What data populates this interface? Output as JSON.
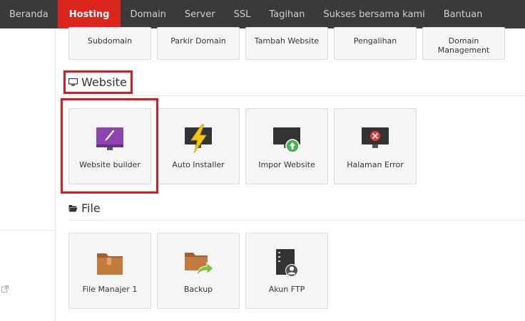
{
  "nav": {
    "items": [
      {
        "label": "Beranda",
        "active": false
      },
      {
        "label": "Hosting",
        "active": true
      },
      {
        "label": "Domain",
        "active": false
      },
      {
        "label": "Server",
        "active": false
      },
      {
        "label": "SSL",
        "active": false
      },
      {
        "label": "Tagihan",
        "active": false
      },
      {
        "label": "Sukses bersama kami",
        "active": false
      },
      {
        "label": "Bantuan",
        "active": false
      }
    ]
  },
  "domain_tiles": [
    {
      "label": "Subdomain"
    },
    {
      "label": "Parkir Domain"
    },
    {
      "label": "Tambah Website"
    },
    {
      "label": "Pengalihan"
    },
    {
      "label": "Domain Management"
    }
  ],
  "website_section": {
    "title": "Website",
    "icon": "monitor-icon",
    "tiles": [
      {
        "label": "Website builder",
        "icon": "monitor-brush-icon"
      },
      {
        "label": "Auto Installer",
        "icon": "monitor-lightning-icon"
      },
      {
        "label": "Impor Website",
        "icon": "monitor-upload-icon"
      },
      {
        "label": "Halaman Error",
        "icon": "monitor-error-icon"
      }
    ]
  },
  "file_section": {
    "title": "File",
    "icon": "folder-open-icon",
    "tiles": [
      {
        "label": "File Manajer 1",
        "icon": "folder-icon"
      },
      {
        "label": "Backup",
        "icon": "folder-share-icon"
      },
      {
        "label": "Akun FTP",
        "icon": "server-user-icon"
      }
    ]
  },
  "colors": {
    "nav_bg": "#3a3a3a",
    "nav_active": "#d9251c",
    "highlight": "#e3171c",
    "folder": "#c27a3f",
    "purple": "#8e44ad",
    "bolt": "#f5c518",
    "green": "#4caf50",
    "error_red": "#e53935"
  }
}
